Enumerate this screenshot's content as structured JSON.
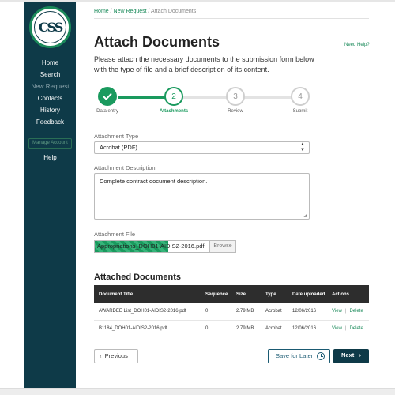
{
  "sidebar": {
    "logo_text": "CSS",
    "logo_ring": "CONTRACT SUBMISSION SYSTEM",
    "items": [
      {
        "label": "Home"
      },
      {
        "label": "Search"
      },
      {
        "label": "New Request"
      },
      {
        "label": "Contacts"
      },
      {
        "label": "History"
      },
      {
        "label": "Feedback"
      }
    ],
    "manage_account": "Manage Account",
    "help": "Help"
  },
  "breadcrumb": {
    "home": "Home",
    "new_request": "New Request",
    "current": "Attach Documents",
    "separator": "/"
  },
  "page": {
    "title": "Attach Documents",
    "need_help": "Need Help?",
    "intro": "Please attach the necessary documents to the submission form below with the type of file and a brief description of its content."
  },
  "steps": [
    {
      "number": "1",
      "label": "Data entry",
      "status": "done"
    },
    {
      "number": "2",
      "label": "Attachments",
      "status": "current"
    },
    {
      "number": "3",
      "label": "Review",
      "status": "todo"
    },
    {
      "number": "4",
      "label": "Submit",
      "status": "todo"
    }
  ],
  "form": {
    "attachment_type_label": "Attachment Type",
    "attachment_type_value": "Acrobat (PDF)",
    "description_label": "Attachment Description",
    "description_value": "Complete contract document description.",
    "file_label": "Attachment File",
    "file_name": "Appropriations_DOH01-AIDIS2-2016.pdf",
    "file_upload_progress": 0.64,
    "browse_label": "Browse"
  },
  "attached": {
    "title": "Attached Documents",
    "columns": [
      "Document Title",
      "Sequence",
      "Size",
      "Type",
      "Date uploaded",
      "Actions"
    ],
    "rows": [
      {
        "title": "AWARDEE List_DOH01-AIDIS2-2016.pdf",
        "sequence": "0",
        "size": "2.79 MB",
        "type": "Acrobat",
        "date": "12/06/2016",
        "view": "View",
        "sep": "|",
        "delete": "Delete"
      },
      {
        "title": "B1184_DOH01-AIDIS2-2016.pdf",
        "sequence": "0",
        "size": "2.79 MB",
        "type": "Acrobat",
        "date": "12/06/2016",
        "view": "View",
        "sep": "|",
        "delete": "Delete"
      }
    ]
  },
  "buttons": {
    "previous": "Previous",
    "save": "Save for Later",
    "next": "Next"
  },
  "colors": {
    "sidebar": "#0e3a48",
    "accent": "#1a9a5e",
    "table_header": "#2d2d2d"
  }
}
